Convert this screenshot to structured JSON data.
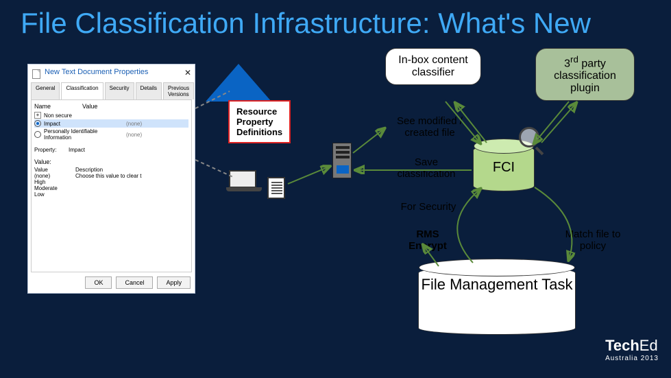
{
  "title": "File Classification Infrastructure: What's New",
  "dialog": {
    "title": "New Text Document Properties",
    "tabs": [
      "General",
      "Classification",
      "Security",
      "Details",
      "Previous Versions"
    ],
    "active_tab": "Classification",
    "col_name": "Name",
    "col_value": "Value",
    "rows": [
      {
        "name": "Non secure",
        "value": ""
      },
      {
        "name": "Impact",
        "value": "(none)",
        "selected": true
      },
      {
        "name": "Personally Identifiable Information",
        "value": "(none)"
      }
    ],
    "property_lbl": "Property:",
    "property_val": "Impact",
    "value_lbl": "Value:",
    "opt_head_value": "Value",
    "opt_head_desc": "Description",
    "options": [
      {
        "v": "(none)",
        "d": "Choose this value to clear t"
      },
      {
        "v": "High",
        "d": ""
      },
      {
        "v": "Moderate",
        "d": ""
      },
      {
        "v": "Low",
        "d": ""
      }
    ],
    "btn_ok": "OK",
    "btn_cancel": "Cancel",
    "btn_apply": "Apply"
  },
  "callout": {
    "l1": "Resource",
    "l2": "Property",
    "l3": "Definitions"
  },
  "pills": {
    "inbox": "In-box content classifier",
    "thirdparty_l1": "3",
    "thirdparty_sup": "rd",
    "thirdparty_rest": " party classification plugin"
  },
  "labels": {
    "see_modified": "See modified / created file",
    "save": "Save classification",
    "for_security": "For Security",
    "rms": "RMS Encrypt",
    "match": "Match file to policy"
  },
  "fci": "FCI",
  "fmt": "File Management Task",
  "brand": {
    "techedA": "Tech",
    "techedB": "Ed",
    "sub": "Australia 2013"
  }
}
